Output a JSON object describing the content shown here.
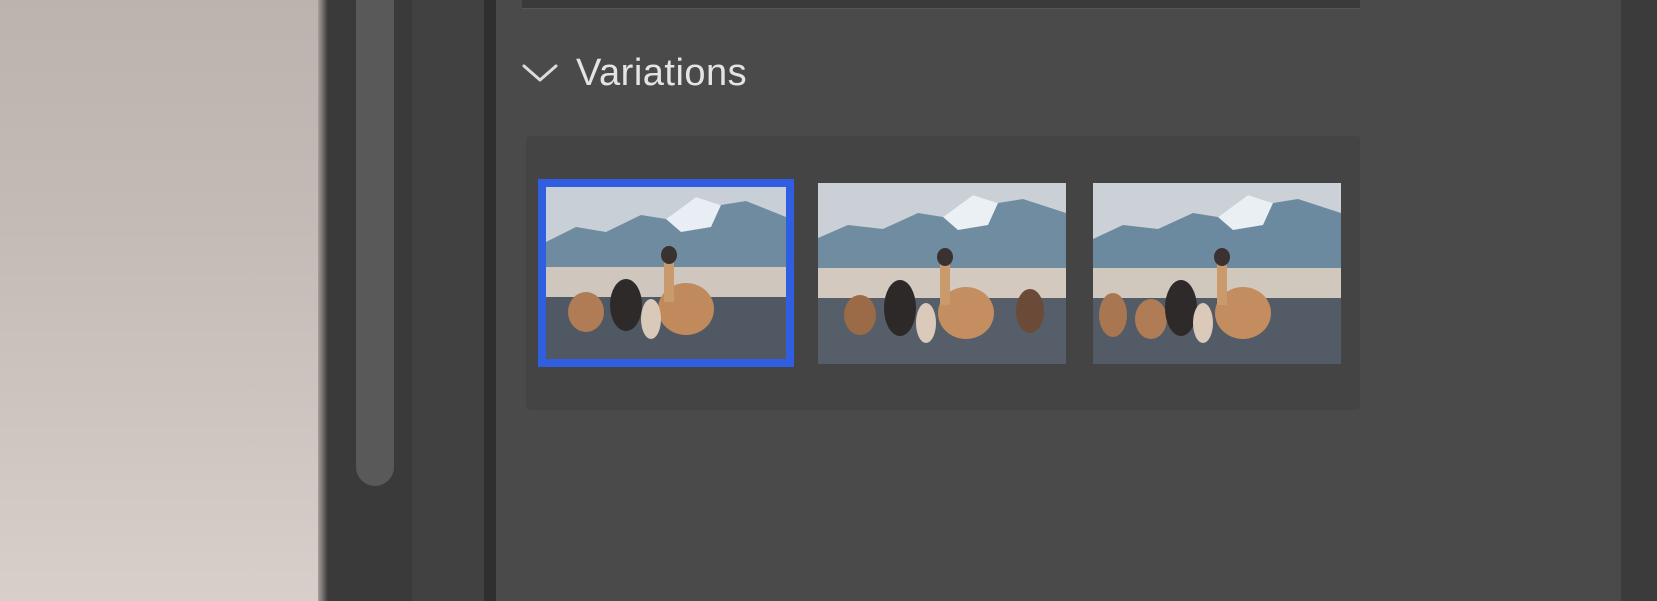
{
  "variations_section": {
    "title": "Variations",
    "expanded": true,
    "chevron_icon": "chevron-down-icon",
    "selected_index": 0,
    "items": [
      {
        "label": "variation-1",
        "selected": true
      },
      {
        "label": "variation-2",
        "selected": false
      },
      {
        "label": "variation-3",
        "selected": false
      }
    ]
  },
  "colors": {
    "selection": "#2f5fe0",
    "panel_bg": "#4a4a4a",
    "title_text": "#e4e4e4"
  }
}
